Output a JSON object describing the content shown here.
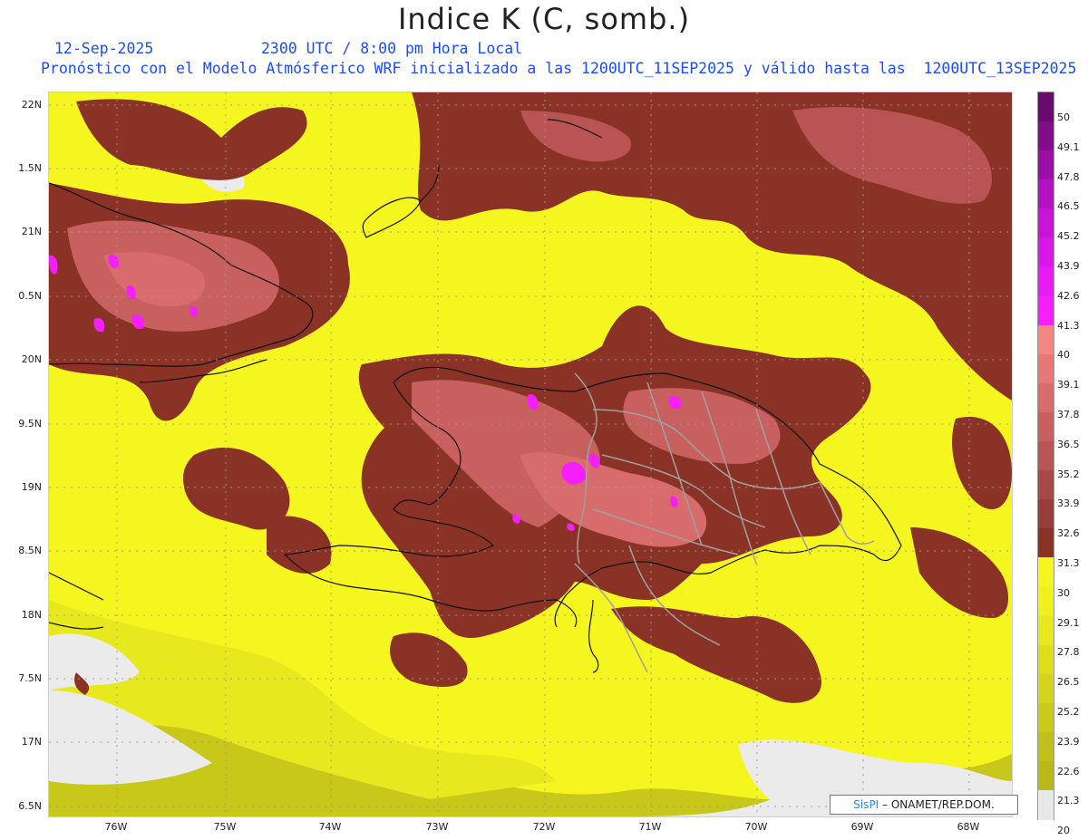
{
  "title": "Indice K (C, somb.)",
  "date": "12-Sep-2025",
  "valid_time": "2300 UTC / 8:00 pm Hora Local",
  "model_note": "Pronóstico con el Modelo Atmósferico WRF inicializado a las 1200UTC_11SEP2025 y válido hasta las  1200UTC_13SEP2025",
  "lat_labels": [
    "22N",
    "1.5N",
    "21N",
    "0.5N",
    "20N",
    "9.5N",
    "19N",
    "8.5N",
    "18N",
    "7.5N",
    "17N",
    "6.5N"
  ],
  "lon_labels": [
    "76W",
    "75W",
    "74W",
    "73W",
    "72W",
    "71W",
    "70W",
    "69W",
    "68W"
  ],
  "colorbar": {
    "labels": [
      "50",
      "49.1",
      "47.8",
      "46.5",
      "45.2",
      "43.9",
      "42.6",
      "41.3",
      "40",
      "39.1",
      "37.8",
      "36.5",
      "35.2",
      "33.9",
      "32.6",
      "31.3",
      "30",
      "29.1",
      "27.8",
      "26.5",
      "25.2",
      "23.9",
      "22.6",
      "21.3",
      "20"
    ],
    "colors": [
      "#6a0a6e",
      "#820c8a",
      "#9a0fa6",
      "#b212c2",
      "#c814d6",
      "#d818e6",
      "#e81cf2",
      "#f41ffa",
      "#f48585",
      "#e67878",
      "#d86c6c",
      "#c86060",
      "#b85454",
      "#a84848",
      "#983c3c",
      "#8a3226",
      "#f5f51f",
      "#f0f01f",
      "#e8e81e",
      "#dede1d",
      "#d4d41c",
      "#caca1b",
      "#c0c01a",
      "#b8b819",
      "#e8e8e8"
    ]
  },
  "credit": {
    "brand": "SisPI",
    "text": "– ONAMET/REP.DOM."
  }
}
